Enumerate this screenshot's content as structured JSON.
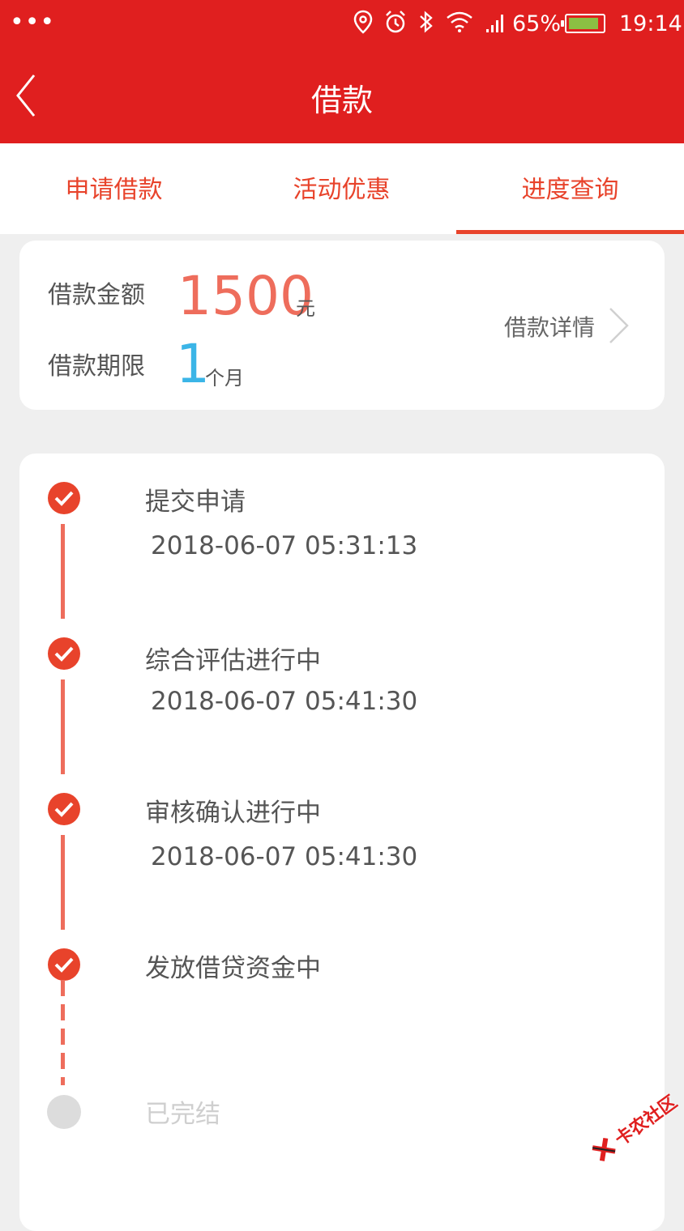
{
  "status_bar": {
    "menu_dots": "•••",
    "battery_percent": "65%",
    "time": "19:14",
    "icons": [
      "location-icon",
      "alarm-icon",
      "bluetooth-icon",
      "wifi-icon",
      "signal-icon",
      "battery-icon"
    ]
  },
  "nav": {
    "title": "借款"
  },
  "tabs": [
    {
      "label": "申请借款",
      "active": false
    },
    {
      "label": "活动优惠",
      "active": false
    },
    {
      "label": "进度查询",
      "active": true
    }
  ],
  "loan": {
    "amount_label": "借款金额",
    "amount": "1500",
    "amount_unit": "元",
    "term_label": "借款期限",
    "term": "1",
    "term_unit": "个月",
    "details_link": "借款详情"
  },
  "progress": [
    {
      "title": "提交申请",
      "time": "2018-06-07 05:31:13",
      "status": "done"
    },
    {
      "title": "综合评估进行中",
      "time": "2018-06-07 05:41:30",
      "status": "done"
    },
    {
      "title": "审核确认进行中",
      "time": "2018-06-07 05:41:30",
      "status": "done"
    },
    {
      "title": "发放借贷资金中",
      "time": "",
      "status": "done"
    },
    {
      "title": "已完结",
      "time": "",
      "status": "pending"
    }
  ],
  "watermark": {
    "text": "卡农社区"
  },
  "colors": {
    "brand_red": "#e01f1f",
    "accent_orange": "#ee6d5c",
    "term_blue": "#3bb5e7"
  }
}
